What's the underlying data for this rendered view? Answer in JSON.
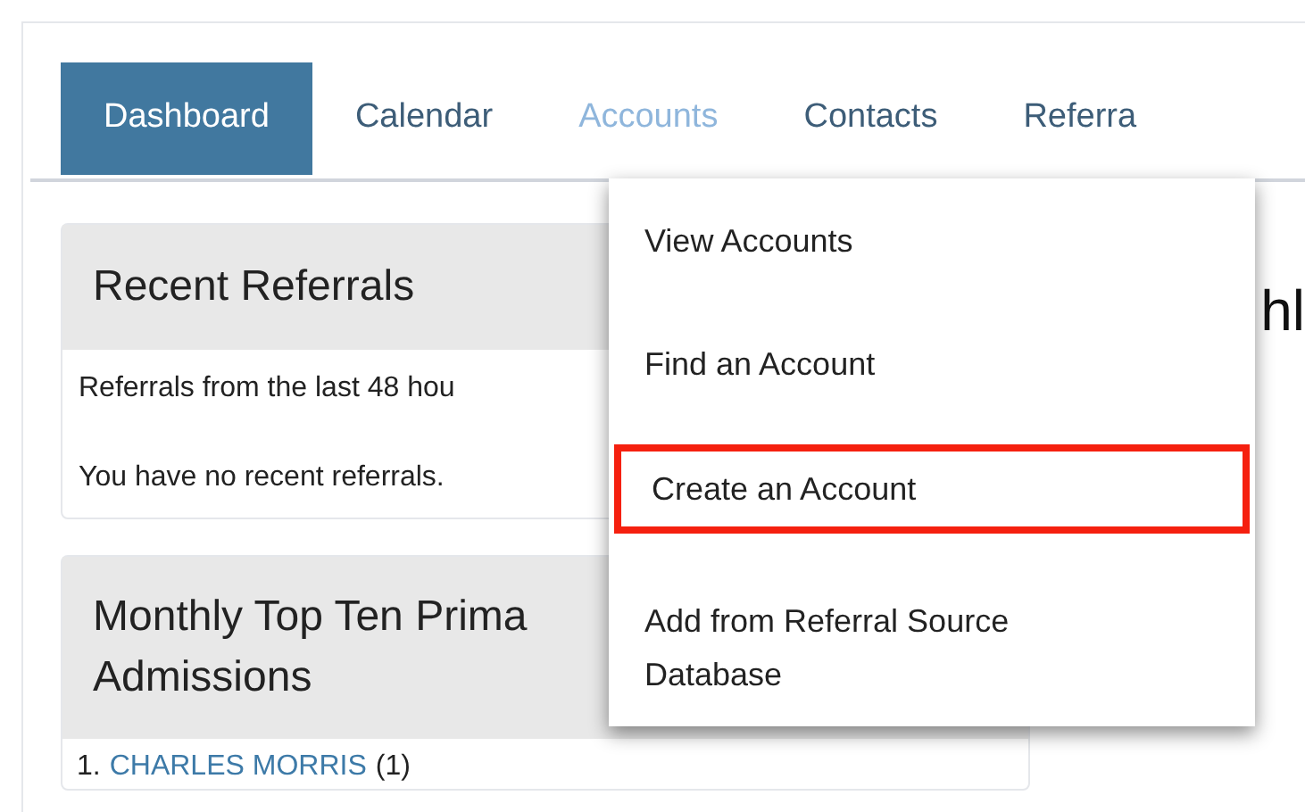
{
  "tabs": [
    {
      "label": "Dashboard",
      "selected": true,
      "expanded": false
    },
    {
      "label": "Calendar",
      "selected": false,
      "expanded": false
    },
    {
      "label": "Accounts",
      "selected": false,
      "expanded": true
    },
    {
      "label": "Contacts",
      "selected": false,
      "expanded": false
    },
    {
      "label": "Referra",
      "selected": false,
      "expanded": false
    }
  ],
  "dropdown": {
    "items": [
      {
        "label": "View Accounts",
        "highlighted": false
      },
      {
        "label": "Find an Account",
        "highlighted": false
      },
      {
        "label": "Create an Account",
        "highlighted": true
      },
      {
        "label": "Add from Referral Source Database",
        "highlighted": false
      }
    ]
  },
  "recent_referrals": {
    "title": "Recent Referrals",
    "lines": [
      "Referrals from the last 48 hou",
      "You have no recent referrals."
    ]
  },
  "top_ten": {
    "title": "Monthly Top Ten Prima Admissions",
    "rows": [
      {
        "name": "CHARLES MORRIS",
        "count": "(1)",
        "number": "1."
      }
    ]
  },
  "right_heading": "hl"
}
